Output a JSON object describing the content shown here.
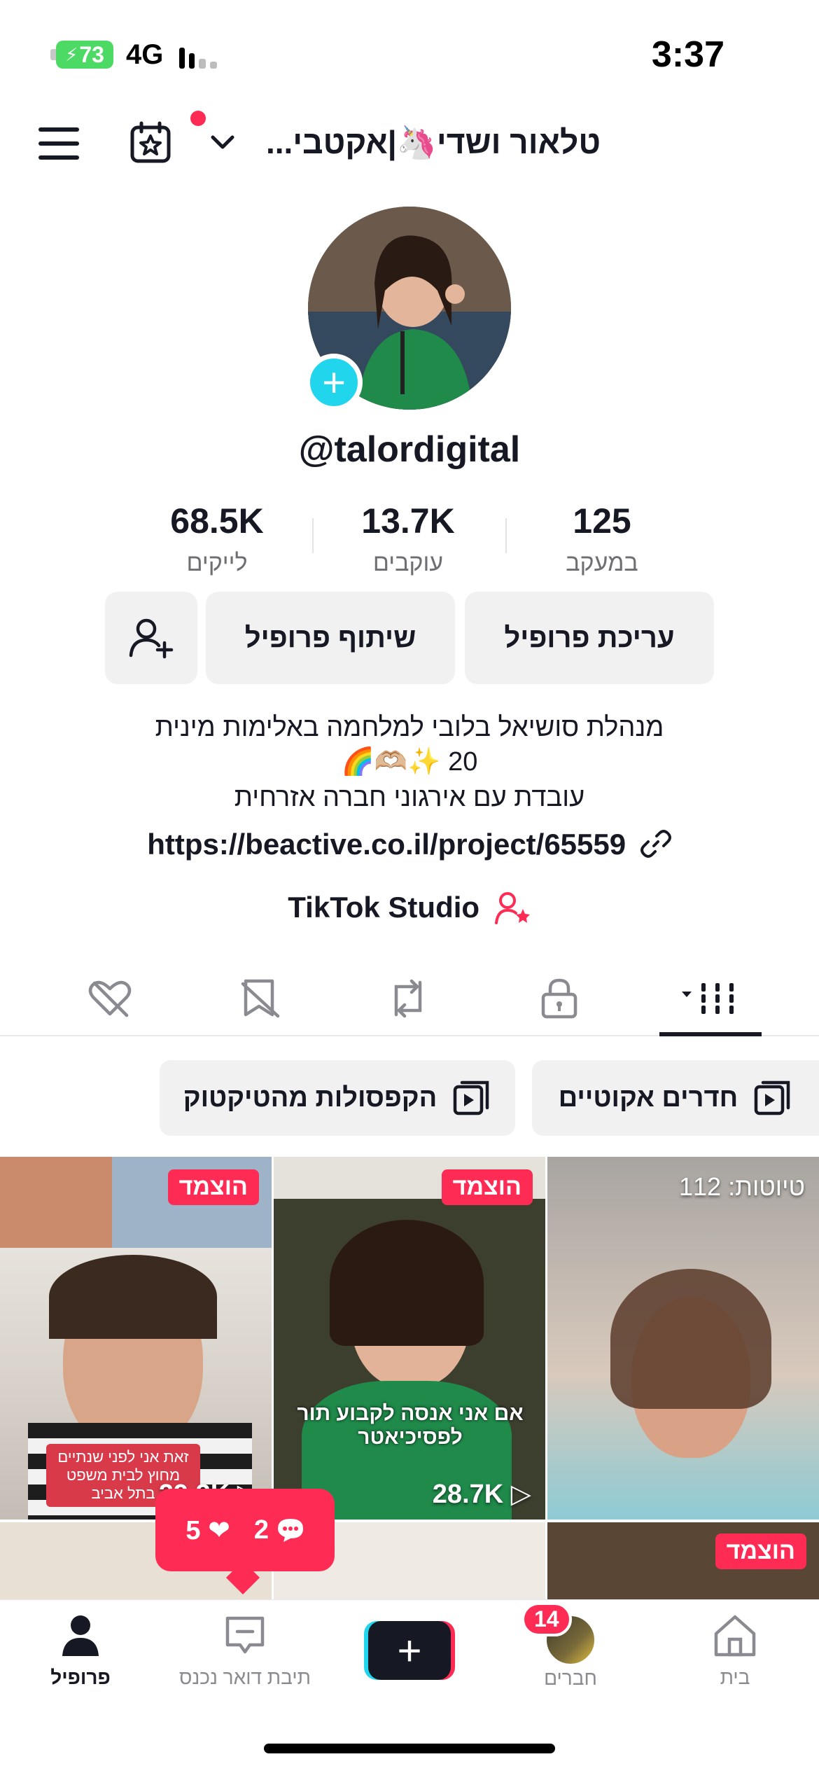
{
  "status_bar": {
    "battery": "73",
    "network": "4G",
    "time": "3:37"
  },
  "header": {
    "account_name": "טלאור ושדי🦄|אקטבי..."
  },
  "profile": {
    "username": "@talordigital",
    "stats": [
      {
        "value": "68.5K",
        "label": "לייקים"
      },
      {
        "value": "13.7K",
        "label": "עוקבים"
      },
      {
        "value": "125",
        "label": "במעקב"
      }
    ],
    "buttons": {
      "edit": "עריכת פרופיל",
      "share": "שיתוף פרופיל"
    },
    "bio": {
      "line1": "מנהלת סושיאל בלובי למלחמה באלימות מינית",
      "line2": "20 ✨🫶🏼🌈",
      "line3": "עובדת עם אירגוני חברה אזרחית"
    },
    "link": "https://beactive.co.il/project/65559",
    "studio": "TikTok Studio"
  },
  "playlists": [
    {
      "label": "חדרים אקוטיים"
    },
    {
      "label": "הקפסולות מהטיקטוק"
    }
  ],
  "grid": {
    "badge_label": "הוצמד",
    "drafts_label": "טיוטות: 112",
    "views": [
      "28.7K",
      "29.3K"
    ],
    "caption_mid": "אם אני אנסה לקבוע תור לפסיכיאטר",
    "caption_left": "זאת אני לפני שנתיים מחוץ לבית משפט בתל אביב"
  },
  "notification": {
    "likes": "5",
    "comments": "2"
  },
  "bottom_nav": {
    "home": "בית",
    "friends": "חברים",
    "friends_badge": "14",
    "inbox": "תיבת דואר נכנס",
    "profile": "פרופיל"
  },
  "colors": {
    "accent": "#fe2c55",
    "cyan": "#20d5ec"
  }
}
